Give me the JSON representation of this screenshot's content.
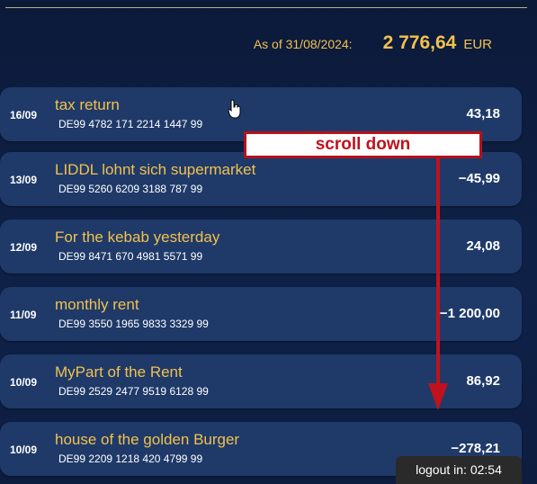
{
  "balance": {
    "as_of_label": "As of 31/08/2024:",
    "amount": "2 776,64",
    "currency": "EUR"
  },
  "transactions": [
    {
      "date": "16/09",
      "title": "tax return",
      "iban": "DE99 4782 171 2214 1447 99",
      "amount": "43,18"
    },
    {
      "date": "13/09",
      "title": "LIDDL lohnt sich supermarket",
      "iban": "DE99 5260 6209 3188 787 99",
      "amount": "−45,99"
    },
    {
      "date": "12/09",
      "title": "For the kebab yesterday",
      "iban": "DE99 8471 670 4981 5571 99",
      "amount": "24,08"
    },
    {
      "date": "11/09",
      "title": "monthly rent",
      "iban": "DE99 3550 1965 9833 3329 99",
      "amount": "−1 200,00"
    },
    {
      "date": "10/09",
      "title": "MyPart of the Rent",
      "iban": "DE99 2529 2477 9519 6128 99",
      "amount": "86,92"
    },
    {
      "date": "10/09",
      "title": "house of the golden Burger",
      "iban": "DE99 2209 1218 420 4799 99",
      "amount": "−278,21"
    }
  ],
  "annotation": {
    "label": "scroll down",
    "color": "#c0121c"
  },
  "session": {
    "logout_text": "logout in: 02:54"
  },
  "colors": {
    "background": "#0f2147",
    "card": "#1f3a69",
    "accent": "#f2c14e"
  },
  "icons": {
    "cursor": "pointer-hand-icon",
    "arrow": "arrow-down-icon"
  }
}
